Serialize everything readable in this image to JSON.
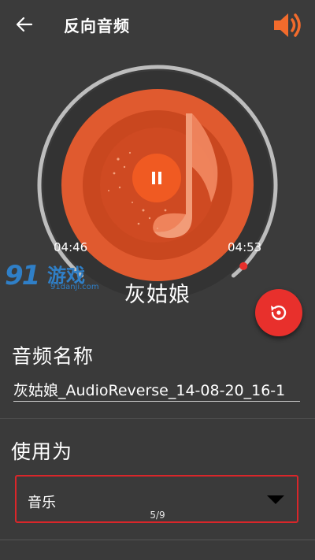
{
  "appbar": {
    "title": "反向音频",
    "back_icon": "arrow-left-icon",
    "volume_icon": "volume-icon"
  },
  "player": {
    "elapsed": "04:46",
    "duration": "04:53",
    "progress": 0.976,
    "track_title": "灰姑娘",
    "pause_icon": "pause-icon",
    "cover_icon": "music-note-icon"
  },
  "watermark": {
    "logo": "91",
    "text": "游戏",
    "sub": "91danji.com"
  },
  "fab": {
    "icon": "reverse-playback-icon"
  },
  "form": {
    "name_label": "音频名称",
    "name_value": "灰姑娘_AudioReverse_14-08-20_16-1",
    "use_label": "使用为",
    "use_value": "音乐",
    "page_indicator": "5/9"
  },
  "colors": {
    "accent": "#e8302c",
    "disc_outer": "#e05a2f",
    "disc_inner": "#c7421f",
    "ring_track": "#bdbdbd",
    "volume": "#f26b2c"
  }
}
